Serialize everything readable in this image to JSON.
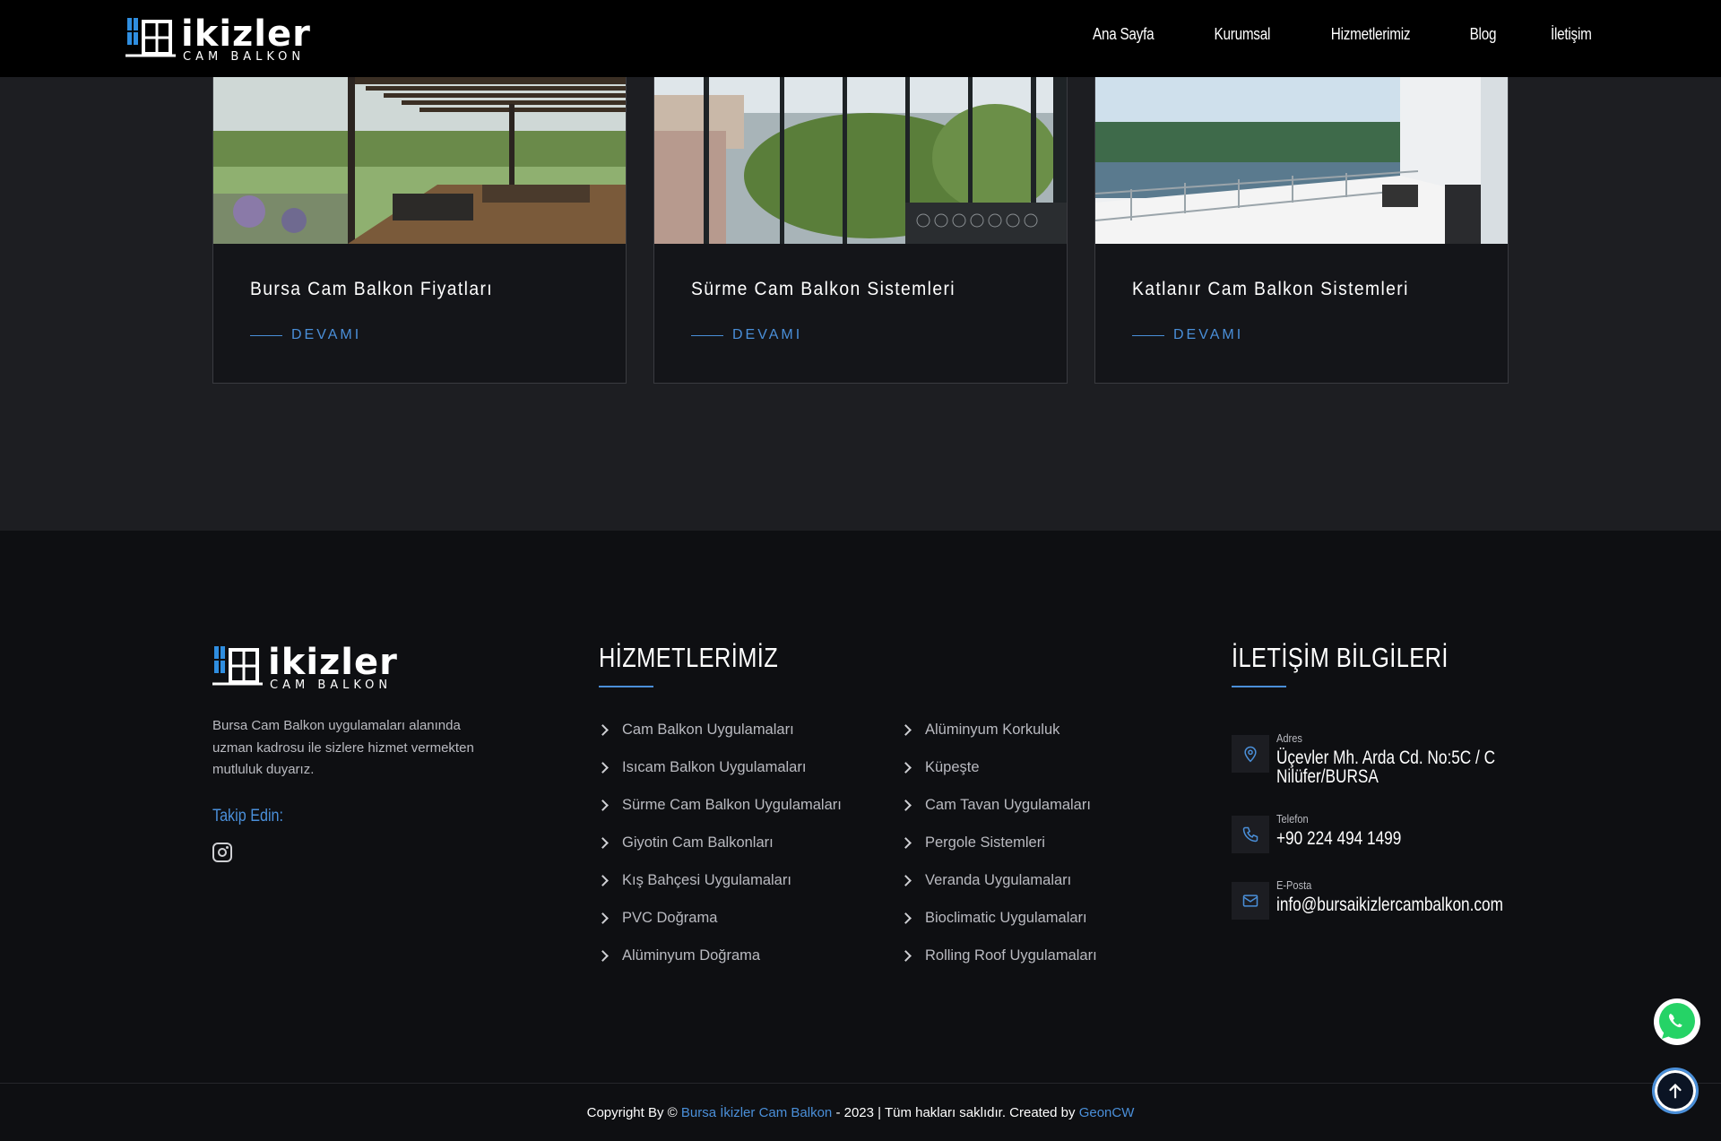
{
  "brand": {
    "name": "ikizler",
    "tagline": "CAM BALKON"
  },
  "nav": [
    "Ana Sayfa",
    "Kurumsal",
    "Hizmetlerimiz",
    "Blog",
    "İletişim"
  ],
  "cards": [
    {
      "title": "Bursa Cam Balkon Fiyatları",
      "more": "DEVAMI"
    },
    {
      "title": "Sürme Cam Balkon Sistemleri",
      "more": "DEVAMI"
    },
    {
      "title": "Katlanır Cam Balkon Sistemleri",
      "more": "DEVAMI"
    }
  ],
  "footer": {
    "about": "Bursa Cam Balkon uygulamaları alanında uzman kadrosu ile sizlere hizmet vermekten mutluluk duyarız.",
    "follow": "Takip Edin:",
    "services_title": "HİZMETLERİMİZ",
    "services_left": [
      "Cam Balkon Uygulamaları",
      "Isıcam Balkon Uygulamaları",
      "Sürme Cam Balkon Uygulamaları",
      "Giyotin Cam Balkonları",
      "Kış Bahçesi Uygulamaları",
      "PVC Doğrama",
      "Alüminyum Doğrama"
    ],
    "services_right": [
      "Alüminyum Korkuluk",
      "Küpeşte",
      "Cam Tavan Uygulamaları",
      "Pergole Sistemleri",
      "Veranda Uygulamaları",
      "Bioclimatic Uygulamaları",
      "Rolling Roof Uygulamaları"
    ],
    "contact_title": "İLETİŞİM BİLGİLERİ",
    "address_label": "Adres",
    "address_line1": "Üçevler Mh. Arda Cd. No:5C / C",
    "address_line2": "Nilüfer/BURSA",
    "phone_label": "Telefon",
    "phone": "+90 224 494 1499",
    "email_label": "E-Posta",
    "email": "info@bursaikizlercambalkon.com"
  },
  "copyright": {
    "prefix": "Copyright By © ",
    "company": "Bursa İkizler Cam Balkon",
    "middle": " - 2023 | Tüm hakları saklıdır. Created by ",
    "creator": "GeonCW"
  },
  "colors": {
    "accent": "#4a8fd9",
    "header": "#000000",
    "footer": "#0e0f12",
    "card": "#141519"
  }
}
